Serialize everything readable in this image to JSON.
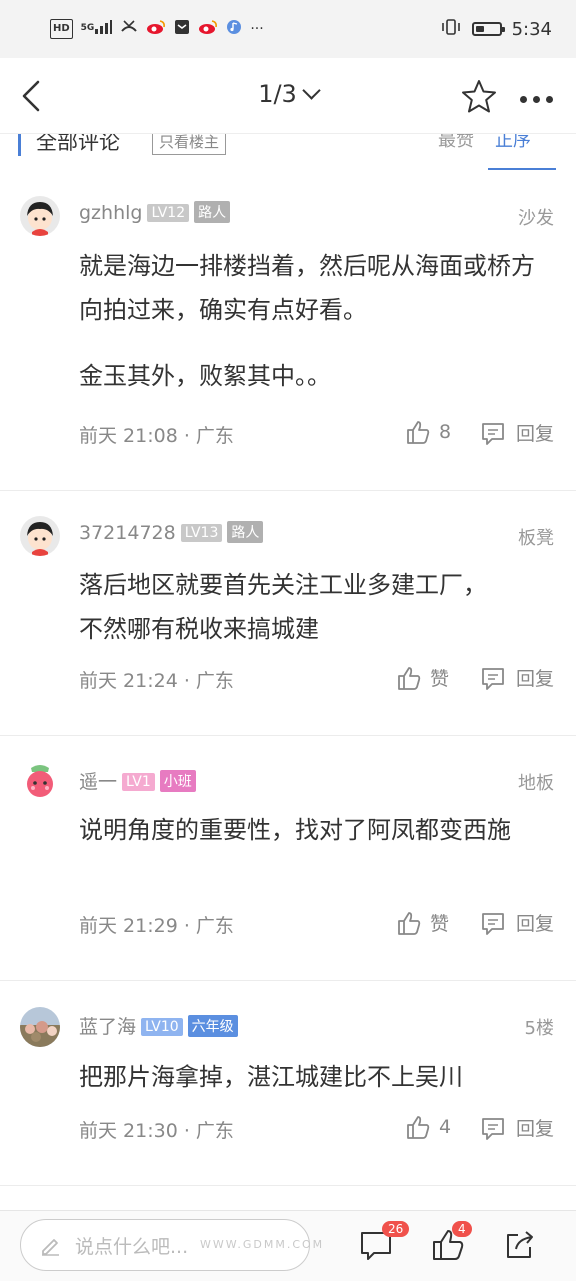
{
  "status_bar": {
    "time": "5:34",
    "hd_label": "HD",
    "signal_label": "5G",
    "icons": [
      "hd-icon",
      "signal-5g-icon",
      "missed-call-icon",
      "weibo-icon",
      "app-icon",
      "weibo-icon",
      "music-icon",
      "more-icon",
      "vibrate-icon",
      "battery-icon"
    ],
    "more_dots": "···",
    "battery_level": 0.35
  },
  "nav": {
    "page_indicator": "1/3"
  },
  "sort_bar": {
    "all_comments": "全部评论",
    "only_op": "只看楼主",
    "sort_hot": "最赞",
    "sort_order": "正序"
  },
  "comments": [
    {
      "username": "gzhhlg",
      "level": "LV12",
      "tag": "路人",
      "floor": "沙发",
      "paragraphs": [
        "就是海边一排楼挡着，然后呢从海面或桥方向拍过来，确实有点好看。",
        "金玉其外，败絮其中。。"
      ],
      "time": "前天 21:08 · 广东",
      "like_label": "8",
      "reply_label": "回复"
    },
    {
      "username": "37214728",
      "level": "LV13",
      "tag": "路人",
      "floor": "板凳",
      "paragraphs": [
        "落后地区就要首先关注工业多建工厂，不然哪有税收来搞城建"
      ],
      "time": "前天 21:24 · 广东",
      "like_label": "赞",
      "reply_label": "回复"
    },
    {
      "username": "遥一",
      "level": "LV1",
      "tag": "小班",
      "floor": "地板",
      "paragraphs": [
        "说明角度的重要性，找对了阿凤都变西施"
      ],
      "time": "前天 21:29 · 广东",
      "like_label": "赞",
      "reply_label": "回复"
    },
    {
      "username": "蓝了海",
      "level": "LV10",
      "tag": "六年级",
      "floor": "5楼",
      "paragraphs": [
        "把那片海拿掉，湛江城建比不上吴川"
      ],
      "time": "前天 21:30 · 广东",
      "like_label": "4",
      "reply_label": "回复"
    }
  ],
  "bottom_bar": {
    "input_placeholder": "说点什么吧...",
    "comment_count": "26",
    "like_count": "4"
  },
  "watermark": "WWW.GDMM.COM",
  "colors": {
    "accent_blue": "#4a7fd6",
    "badge_red": "#f0514b",
    "pink_tag": "#e77bc1",
    "blue_tag": "#5b8fe0"
  }
}
